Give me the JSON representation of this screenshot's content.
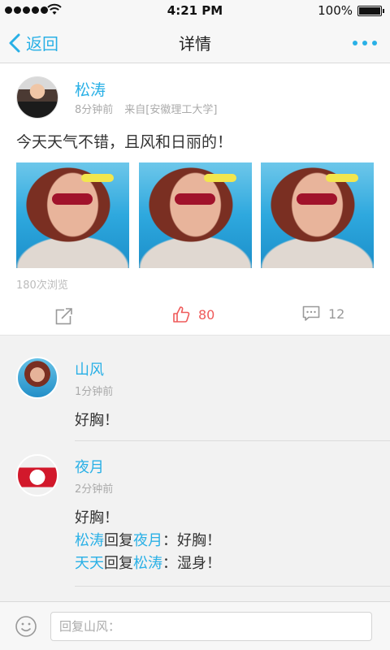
{
  "status_bar": {
    "time": "4:21 PM",
    "battery": "100%"
  },
  "nav": {
    "back_label": "返回",
    "title": "详情"
  },
  "post": {
    "author": "松涛",
    "time": "8分钟前",
    "source": "来自[安徽理工大学]",
    "content": "今天天气不错，且风和日丽的！",
    "views": "180次浏览",
    "likes": "80",
    "comments_count": "12"
  },
  "comments": [
    {
      "author": "山风",
      "time": "1分钟前",
      "text": "好胸！"
    },
    {
      "author": "夜月",
      "time": "2分钟前",
      "text": "好胸！",
      "replies": [
        {
          "from": "松涛",
          "verb": "回复",
          "to": "夜月",
          "sep": "：",
          "text": "好胸！"
        },
        {
          "from": "天天",
          "verb": "回复",
          "to": "松涛",
          "sep": "：",
          "text": "湿身！"
        }
      ]
    }
  ],
  "input": {
    "placeholder": "回复山风："
  },
  "colors": {
    "accent": "#29b0e6",
    "like": "#ef5a5a"
  }
}
